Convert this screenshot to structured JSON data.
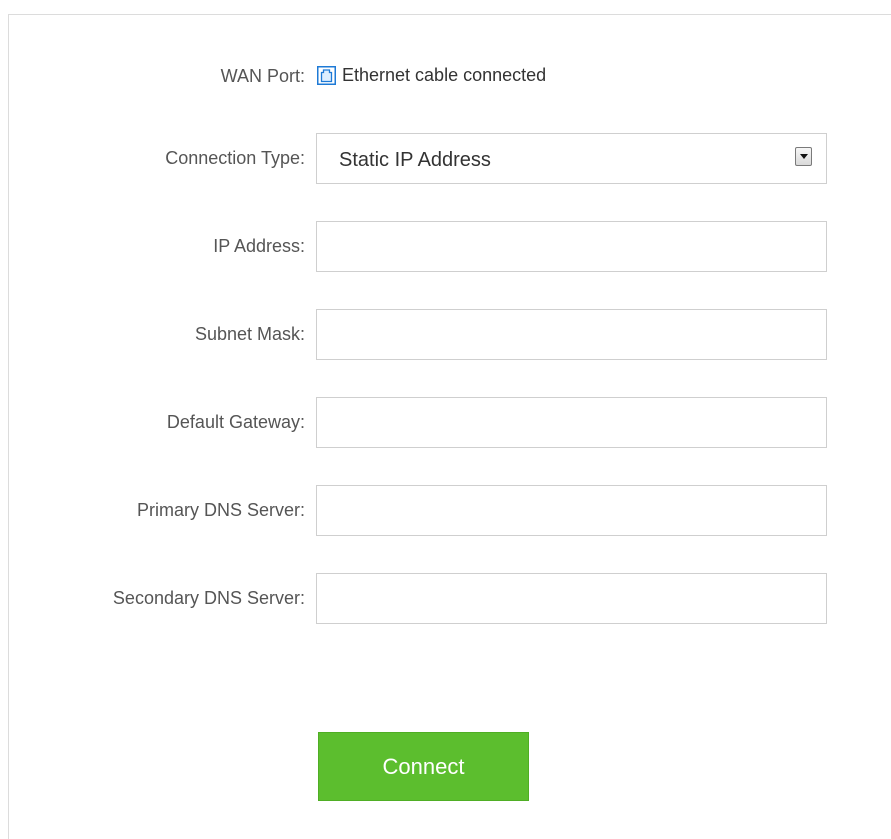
{
  "wan_port": {
    "label": "WAN Port:",
    "status_icon": "ethernet-port-icon",
    "status_text": "Ethernet cable connected"
  },
  "connection_type": {
    "label": "Connection Type:",
    "selected": "Static IP Address"
  },
  "fields": {
    "ip_address": {
      "label": "IP Address:",
      "value": ""
    },
    "subnet_mask": {
      "label": "Subnet Mask:",
      "value": ""
    },
    "default_gateway": {
      "label": "Default Gateway:",
      "value": ""
    },
    "primary_dns": {
      "label": "Primary DNS Server:",
      "value": ""
    },
    "secondary_dns": {
      "label": "Secondary DNS Server:",
      "value": ""
    }
  },
  "connect_button": {
    "label": "Connect"
  },
  "colors": {
    "accent_blue": "#1e7ad6",
    "button_green": "#5cbe2e"
  }
}
